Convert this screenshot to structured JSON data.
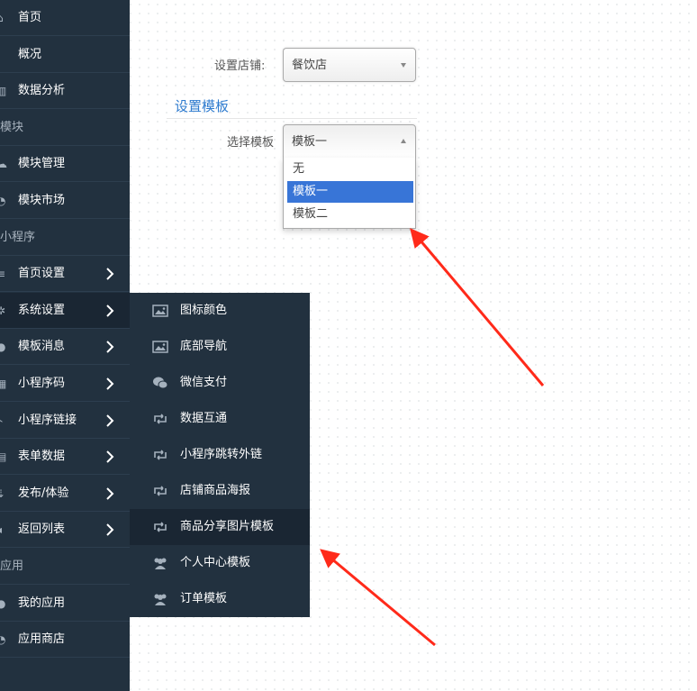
{
  "sidebar": {
    "items": [
      {
        "label": "首页",
        "icon": "home-icon",
        "chevron": false
      },
      {
        "label": "概况",
        "icon": "overview-icon",
        "chevron": false
      },
      {
        "label": "数据分析",
        "icon": "bar-chart-icon",
        "chevron": false
      },
      {
        "section": "模块"
      },
      {
        "label": "模块管理",
        "icon": "cloud-icon",
        "chevron": false
      },
      {
        "label": "模块市场",
        "icon": "market-icon",
        "chevron": false
      },
      {
        "section": "小程序"
      },
      {
        "label": "首页设置",
        "icon": "list-icon",
        "chevron": true
      },
      {
        "label": "系统设置",
        "icon": "cog-icon",
        "chevron": true,
        "active": true
      },
      {
        "label": "模板消息",
        "icon": "message-icon",
        "chevron": true
      },
      {
        "label": "小程序码",
        "icon": "qrcode-icon",
        "chevron": true
      },
      {
        "label": "小程序链接",
        "icon": "link-icon",
        "chevron": true
      },
      {
        "label": "表单数据",
        "icon": "table-icon",
        "chevron": true
      },
      {
        "label": "发布/体验",
        "icon": "publish-icon",
        "chevron": true
      },
      {
        "label": "返回列表",
        "icon": "back-icon",
        "chevron": true
      },
      {
        "section": "应用"
      },
      {
        "label": "我的应用",
        "icon": "app-icon",
        "chevron": false
      },
      {
        "label": "应用商店",
        "icon": "store-icon",
        "chevron": false
      }
    ]
  },
  "submenu": {
    "items": [
      {
        "label": "图标颜色",
        "icon": "image-icon"
      },
      {
        "label": "底部导航",
        "icon": "image-icon"
      },
      {
        "label": "微信支付",
        "icon": "wechat-icon"
      },
      {
        "label": "数据互通",
        "icon": "retweet-icon"
      },
      {
        "label": "小程序跳转外链",
        "icon": "retweet-icon"
      },
      {
        "label": "店铺商品海报",
        "icon": "retweet-icon"
      },
      {
        "label": "商品分享图片模板",
        "icon": "retweet-icon",
        "active": true
      },
      {
        "label": "个人中心模板",
        "icon": "users-icon"
      },
      {
        "label": "订单模板",
        "icon": "users-icon"
      }
    ]
  },
  "form": {
    "shop_label": "设置店铺:",
    "shop_value": "餐饮店",
    "section_title": "设置模板",
    "template_label": "选择模板",
    "template_value": "模板一",
    "template_options": [
      "无",
      "模板一",
      "模板二"
    ],
    "template_selected_index": 1
  },
  "colors": {
    "sidebar_bg": "#22313f",
    "sidebar_active": "#1a2633",
    "heading_blue": "#2e7bcf",
    "option_selected": "#3875d7",
    "annotation_arrow": "#ff2a1a"
  }
}
